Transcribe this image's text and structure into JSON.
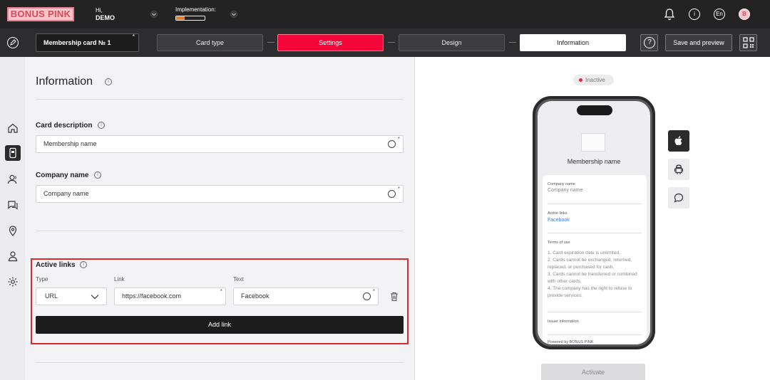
{
  "brand": {
    "logo_text": "BONUS PINK"
  },
  "user": {
    "greeting": "Hi,",
    "name": "DEMO"
  },
  "implementation": {
    "label": "Implementation:",
    "progress_fraction": 0.3
  },
  "header_icons": [
    "bell-icon",
    "info-icon",
    "language-icon",
    "profile-icon"
  ],
  "language": "En",
  "profile_initial": "B",
  "toolbar": {
    "card_name": "Membership card № 1",
    "steps": [
      "Card type",
      "Settings",
      "Design",
      "Information"
    ],
    "active_step": "Settings",
    "current_step": "Information",
    "help_label": "?",
    "save_label": "Save and preview"
  },
  "sidebar": {
    "items": [
      "home-icon",
      "card-icon",
      "customers-icon",
      "chat-icon",
      "location-icon",
      "user-icon",
      "settings-icon"
    ],
    "active": "card-icon"
  },
  "form": {
    "title": "Information",
    "card_description": {
      "label": "Card description",
      "value": "Membership name"
    },
    "company_name": {
      "label": "Company name",
      "value": "Company name"
    },
    "active_links": {
      "label": "Active links",
      "type_label": "Type",
      "link_label": "Link",
      "text_label": "Text",
      "type_value": "URL",
      "link_value": "https://facebook.com",
      "text_value": "Facebook",
      "add_label": "Add link"
    }
  },
  "preview": {
    "status": "Inactive",
    "membership_name": "Membership name",
    "company_label": "Company name",
    "company_value": "Company name",
    "links_label": "Active links",
    "links_value": "Facebook",
    "terms_label": "Terms of use",
    "terms_text": "1. Card expiration date is unlimited.\n2. Cards cannot be exchanged, returned, replaced, or purchased for cash.\n3. Cards cannot be transferred or combined with other cards.\n4. The company has the right to refuse to provide services.",
    "issuer_label": "Issuer information",
    "powered_by": "Powered by BONUS PINK",
    "platforms": [
      "apple-icon",
      "android-icon",
      "message-icon"
    ],
    "active_platform": "apple-icon",
    "activate_label": "Activate"
  },
  "colors": {
    "accent": "#f4063a",
    "dark": "#232323",
    "highlight_box": "#d92b2b"
  }
}
